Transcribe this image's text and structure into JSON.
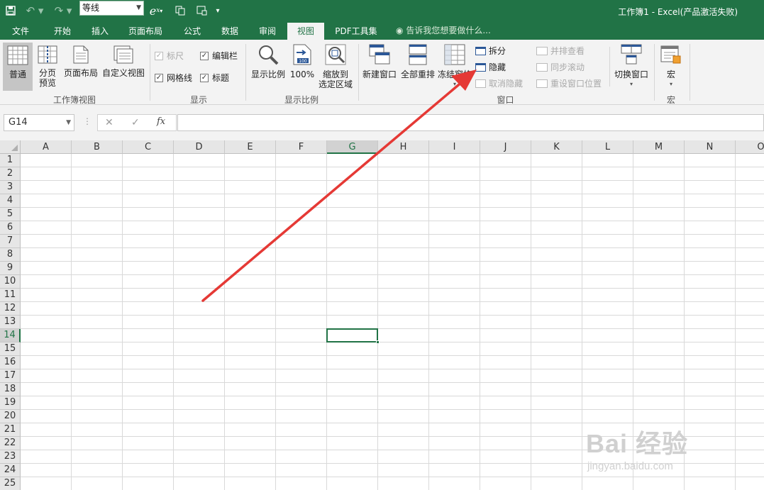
{
  "quick_access": {
    "font_name": "等线",
    "window_title": "工作簿1 - Excel(产品激活失败)"
  },
  "tabs": [
    {
      "label": "文件"
    },
    {
      "label": "开始"
    },
    {
      "label": "插入"
    },
    {
      "label": "页面布局"
    },
    {
      "label": "公式"
    },
    {
      "label": "数据"
    },
    {
      "label": "审阅"
    },
    {
      "label": "视图"
    },
    {
      "label": "PDF工具集"
    }
  ],
  "tell_me": "告诉我您想要做什么...",
  "ribbon": {
    "workbook_views": {
      "label": "工作簿视图",
      "normal": "普通",
      "page_break_1": "分页",
      "page_break_2": "预览",
      "page_layout": "页面布局",
      "custom_views": "自定义视图"
    },
    "show": {
      "label": "显示",
      "ruler": "标尺",
      "formula_bar": "编辑栏",
      "gridlines": "网格线",
      "headings": "标题"
    },
    "zoom": {
      "label": "显示比例",
      "zoom": "显示比例",
      "zoom100": "100%",
      "zoom_sel_1": "缩放到",
      "zoom_sel_2": "选定区域"
    },
    "window": {
      "label": "窗口",
      "new_window": "新建窗口",
      "arrange_all": "全部重排",
      "freeze_panes": "冻结窗格",
      "split": "拆分",
      "hide": "隐藏",
      "unhide": "取消隐藏",
      "side_by_side": "并排查看",
      "sync_scroll": "同步滚动",
      "reset_pos": "重设窗口位置",
      "switch_windows": "切换窗口"
    },
    "macros": {
      "label": "宏",
      "macros": "宏"
    }
  },
  "formula_bar": {
    "name_box": "G14",
    "fx": "fx",
    "cancel": "✕",
    "enter": "✓"
  },
  "grid": {
    "columns": [
      "A",
      "B",
      "C",
      "D",
      "E",
      "F",
      "G",
      "H",
      "I",
      "J",
      "K",
      "L",
      "M",
      "N",
      "O"
    ],
    "rows": [
      "1",
      "2",
      "3",
      "4",
      "5",
      "6",
      "7",
      "8",
      "9",
      "10",
      "11",
      "12",
      "13",
      "14",
      "15",
      "16",
      "17",
      "18",
      "19",
      "20",
      "21",
      "22",
      "23",
      "24",
      "25"
    ],
    "selected_column": "G",
    "selected_row": "14"
  },
  "watermark": {
    "main": "Bai 经验",
    "sub": "jingyan.baidu.com"
  },
  "colors": {
    "excel_green": "#217346",
    "arrow_red": "#e53935"
  }
}
